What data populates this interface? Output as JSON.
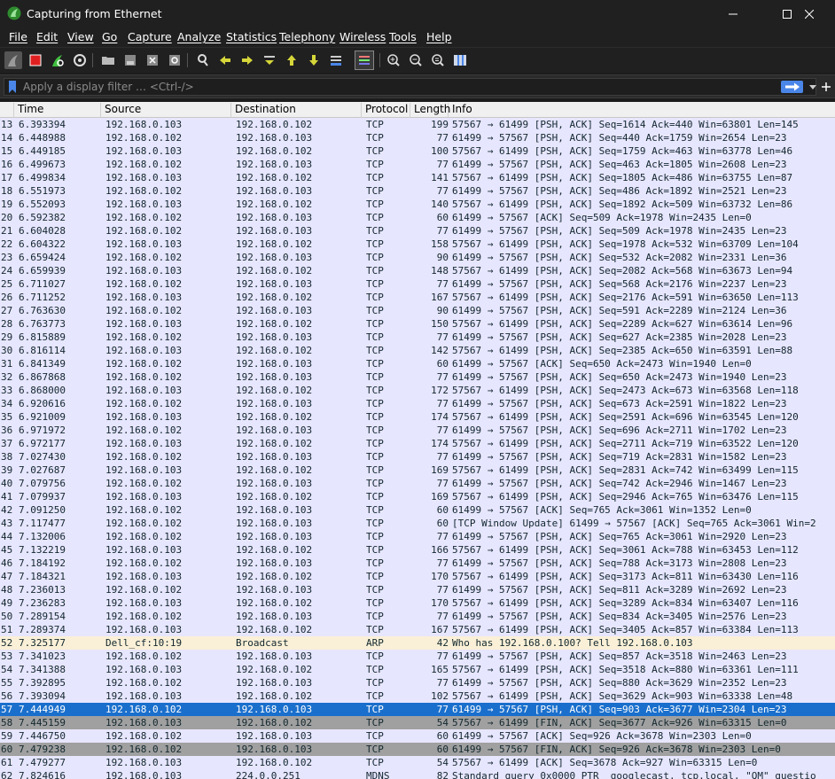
{
  "window": {
    "title": "Capturing from Ethernet"
  },
  "menu": [
    "File",
    "Edit",
    "View",
    "Go",
    "Capture",
    "Analyze",
    "Statistics",
    "Telephony",
    "Wireless",
    "Tools",
    "Help"
  ],
  "toolbar_icons": [
    "shark-fin-start-icon",
    "stop-capture-icon",
    "restart-capture-icon",
    "capture-options-icon",
    "open-file-icon",
    "save-file-icon",
    "close-file-icon",
    "reload-file-icon",
    "find-packet-icon",
    "go-back-icon",
    "go-forward-icon",
    "go-to-packet-icon",
    "go-first-icon",
    "go-last-icon",
    "autoscroll-icon",
    "colorize-icon",
    "zoom-in-icon",
    "zoom-out-icon",
    "normal-size-icon",
    "resize-columns-icon"
  ],
  "filter": {
    "placeholder": "Apply a display filter … <Ctrl-/>"
  },
  "columns": [
    "Time",
    "Source",
    "Destination",
    "Protocol",
    "Length",
    "Info"
  ],
  "colors": {
    "tcp_row": "#e7e6ff",
    "arp_row": "#faf0d7",
    "fin_row": "#a0a0a0",
    "selected_row": "#1a6fcc"
  },
  "packets": [
    {
      "no": "13",
      "time": "6.393394",
      "src": "192.168.0.103",
      "dst": "192.168.0.102",
      "proto": "TCP",
      "len": "199",
      "info": "57567 → 61499 [PSH, ACK] Seq=1614 Ack=440 Win=63801 Len=145",
      "style": "tcp"
    },
    {
      "no": "14",
      "time": "6.448988",
      "src": "192.168.0.102",
      "dst": "192.168.0.103",
      "proto": "TCP",
      "len": "77",
      "info": "61499 → 57567 [PSH, ACK] Seq=440 Ack=1759 Win=2654 Len=23",
      "style": "tcp"
    },
    {
      "no": "15",
      "time": "6.449185",
      "src": "192.168.0.103",
      "dst": "192.168.0.102",
      "proto": "TCP",
      "len": "100",
      "info": "57567 → 61499 [PSH, ACK] Seq=1759 Ack=463 Win=63778 Len=46",
      "style": "tcp"
    },
    {
      "no": "16",
      "time": "6.499673",
      "src": "192.168.0.102",
      "dst": "192.168.0.103",
      "proto": "TCP",
      "len": "77",
      "info": "61499 → 57567 [PSH, ACK] Seq=463 Ack=1805 Win=2608 Len=23",
      "style": "tcp"
    },
    {
      "no": "17",
      "time": "6.499834",
      "src": "192.168.0.103",
      "dst": "192.168.0.102",
      "proto": "TCP",
      "len": "141",
      "info": "57567 → 61499 [PSH, ACK] Seq=1805 Ack=486 Win=63755 Len=87",
      "style": "tcp"
    },
    {
      "no": "18",
      "time": "6.551973",
      "src": "192.168.0.102",
      "dst": "192.168.0.103",
      "proto": "TCP",
      "len": "77",
      "info": "61499 → 57567 [PSH, ACK] Seq=486 Ack=1892 Win=2521 Len=23",
      "style": "tcp"
    },
    {
      "no": "19",
      "time": "6.552093",
      "src": "192.168.0.103",
      "dst": "192.168.0.102",
      "proto": "TCP",
      "len": "140",
      "info": "57567 → 61499 [PSH, ACK] Seq=1892 Ack=509 Win=63732 Len=86",
      "style": "tcp"
    },
    {
      "no": "20",
      "time": "6.592382",
      "src": "192.168.0.102",
      "dst": "192.168.0.103",
      "proto": "TCP",
      "len": "60",
      "info": "61499 → 57567 [ACK] Seq=509 Ack=1978 Win=2435 Len=0",
      "style": "tcp"
    },
    {
      "no": "21",
      "time": "6.604028",
      "src": "192.168.0.102",
      "dst": "192.168.0.103",
      "proto": "TCP",
      "len": "77",
      "info": "61499 → 57567 [PSH, ACK] Seq=509 Ack=1978 Win=2435 Len=23",
      "style": "tcp"
    },
    {
      "no": "22",
      "time": "6.604322",
      "src": "192.168.0.103",
      "dst": "192.168.0.102",
      "proto": "TCP",
      "len": "158",
      "info": "57567 → 61499 [PSH, ACK] Seq=1978 Ack=532 Win=63709 Len=104",
      "style": "tcp"
    },
    {
      "no": "23",
      "time": "6.659424",
      "src": "192.168.0.102",
      "dst": "192.168.0.103",
      "proto": "TCP",
      "len": "90",
      "info": "61499 → 57567 [PSH, ACK] Seq=532 Ack=2082 Win=2331 Len=36",
      "style": "tcp"
    },
    {
      "no": "24",
      "time": "6.659939",
      "src": "192.168.0.103",
      "dst": "192.168.0.102",
      "proto": "TCP",
      "len": "148",
      "info": "57567 → 61499 [PSH, ACK] Seq=2082 Ack=568 Win=63673 Len=94",
      "style": "tcp"
    },
    {
      "no": "25",
      "time": "6.711027",
      "src": "192.168.0.102",
      "dst": "192.168.0.103",
      "proto": "TCP",
      "len": "77",
      "info": "61499 → 57567 [PSH, ACK] Seq=568 Ack=2176 Win=2237 Len=23",
      "style": "tcp"
    },
    {
      "no": "26",
      "time": "6.711252",
      "src": "192.168.0.103",
      "dst": "192.168.0.102",
      "proto": "TCP",
      "len": "167",
      "info": "57567 → 61499 [PSH, ACK] Seq=2176 Ack=591 Win=63650 Len=113",
      "style": "tcp"
    },
    {
      "no": "27",
      "time": "6.763630",
      "src": "192.168.0.102",
      "dst": "192.168.0.103",
      "proto": "TCP",
      "len": "90",
      "info": "61499 → 57567 [PSH, ACK] Seq=591 Ack=2289 Win=2124 Len=36",
      "style": "tcp"
    },
    {
      "no": "28",
      "time": "6.763773",
      "src": "192.168.0.103",
      "dst": "192.168.0.102",
      "proto": "TCP",
      "len": "150",
      "info": "57567 → 61499 [PSH, ACK] Seq=2289 Ack=627 Win=63614 Len=96",
      "style": "tcp"
    },
    {
      "no": "29",
      "time": "6.815889",
      "src": "192.168.0.102",
      "dst": "192.168.0.103",
      "proto": "TCP",
      "len": "77",
      "info": "61499 → 57567 [PSH, ACK] Seq=627 Ack=2385 Win=2028 Len=23",
      "style": "tcp"
    },
    {
      "no": "30",
      "time": "6.816114",
      "src": "192.168.0.103",
      "dst": "192.168.0.102",
      "proto": "TCP",
      "len": "142",
      "info": "57567 → 61499 [PSH, ACK] Seq=2385 Ack=650 Win=63591 Len=88",
      "style": "tcp"
    },
    {
      "no": "31",
      "time": "6.841349",
      "src": "192.168.0.102",
      "dst": "192.168.0.103",
      "proto": "TCP",
      "len": "60",
      "info": "61499 → 57567 [ACK] Seq=650 Ack=2473 Win=1940 Len=0",
      "style": "tcp"
    },
    {
      "no": "32",
      "time": "6.867868",
      "src": "192.168.0.102",
      "dst": "192.168.0.103",
      "proto": "TCP",
      "len": "77",
      "info": "61499 → 57567 [PSH, ACK] Seq=650 Ack=2473 Win=1940 Len=23",
      "style": "tcp"
    },
    {
      "no": "33",
      "time": "6.868000",
      "src": "192.168.0.103",
      "dst": "192.168.0.102",
      "proto": "TCP",
      "len": "172",
      "info": "57567 → 61499 [PSH, ACK] Seq=2473 Ack=673 Win=63568 Len=118",
      "style": "tcp"
    },
    {
      "no": "34",
      "time": "6.920616",
      "src": "192.168.0.102",
      "dst": "192.168.0.103",
      "proto": "TCP",
      "len": "77",
      "info": "61499 → 57567 [PSH, ACK] Seq=673 Ack=2591 Win=1822 Len=23",
      "style": "tcp"
    },
    {
      "no": "35",
      "time": "6.921009",
      "src": "192.168.0.103",
      "dst": "192.168.0.102",
      "proto": "TCP",
      "len": "174",
      "info": "57567 → 61499 [PSH, ACK] Seq=2591 Ack=696 Win=63545 Len=120",
      "style": "tcp"
    },
    {
      "no": "36",
      "time": "6.971972",
      "src": "192.168.0.102",
      "dst": "192.168.0.103",
      "proto": "TCP",
      "len": "77",
      "info": "61499 → 57567 [PSH, ACK] Seq=696 Ack=2711 Win=1702 Len=23",
      "style": "tcp"
    },
    {
      "no": "37",
      "time": "6.972177",
      "src": "192.168.0.103",
      "dst": "192.168.0.102",
      "proto": "TCP",
      "len": "174",
      "info": "57567 → 61499 [PSH, ACK] Seq=2711 Ack=719 Win=63522 Len=120",
      "style": "tcp"
    },
    {
      "no": "38",
      "time": "7.027430",
      "src": "192.168.0.102",
      "dst": "192.168.0.103",
      "proto": "TCP",
      "len": "77",
      "info": "61499 → 57567 [PSH, ACK] Seq=719 Ack=2831 Win=1582 Len=23",
      "style": "tcp"
    },
    {
      "no": "39",
      "time": "7.027687",
      "src": "192.168.0.103",
      "dst": "192.168.0.102",
      "proto": "TCP",
      "len": "169",
      "info": "57567 → 61499 [PSH, ACK] Seq=2831 Ack=742 Win=63499 Len=115",
      "style": "tcp"
    },
    {
      "no": "40",
      "time": "7.079756",
      "src": "192.168.0.102",
      "dst": "192.168.0.103",
      "proto": "TCP",
      "len": "77",
      "info": "61499 → 57567 [PSH, ACK] Seq=742 Ack=2946 Win=1467 Len=23",
      "style": "tcp"
    },
    {
      "no": "41",
      "time": "7.079937",
      "src": "192.168.0.103",
      "dst": "192.168.0.102",
      "proto": "TCP",
      "len": "169",
      "info": "57567 → 61499 [PSH, ACK] Seq=2946 Ack=765 Win=63476 Len=115",
      "style": "tcp"
    },
    {
      "no": "42",
      "time": "7.091250",
      "src": "192.168.0.102",
      "dst": "192.168.0.103",
      "proto": "TCP",
      "len": "60",
      "info": "61499 → 57567 [ACK] Seq=765 Ack=3061 Win=1352 Len=0",
      "style": "tcp"
    },
    {
      "no": "43",
      "time": "7.117477",
      "src": "192.168.0.102",
      "dst": "192.168.0.103",
      "proto": "TCP",
      "len": "60",
      "info": "[TCP Window Update] 61499 → 57567 [ACK] Seq=765 Ack=3061 Win=2",
      "style": "tcp"
    },
    {
      "no": "44",
      "time": "7.132006",
      "src": "192.168.0.102",
      "dst": "192.168.0.103",
      "proto": "TCP",
      "len": "77",
      "info": "61499 → 57567 [PSH, ACK] Seq=765 Ack=3061 Win=2920 Len=23",
      "style": "tcp"
    },
    {
      "no": "45",
      "time": "7.132219",
      "src": "192.168.0.103",
      "dst": "192.168.0.102",
      "proto": "TCP",
      "len": "166",
      "info": "57567 → 61499 [PSH, ACK] Seq=3061 Ack=788 Win=63453 Len=112",
      "style": "tcp"
    },
    {
      "no": "46",
      "time": "7.184192",
      "src": "192.168.0.102",
      "dst": "192.168.0.103",
      "proto": "TCP",
      "len": "77",
      "info": "61499 → 57567 [PSH, ACK] Seq=788 Ack=3173 Win=2808 Len=23",
      "style": "tcp"
    },
    {
      "no": "47",
      "time": "7.184321",
      "src": "192.168.0.103",
      "dst": "192.168.0.102",
      "proto": "TCP",
      "len": "170",
      "info": "57567 → 61499 [PSH, ACK] Seq=3173 Ack=811 Win=63430 Len=116",
      "style": "tcp"
    },
    {
      "no": "48",
      "time": "7.236013",
      "src": "192.168.0.102",
      "dst": "192.168.0.103",
      "proto": "TCP",
      "len": "77",
      "info": "61499 → 57567 [PSH, ACK] Seq=811 Ack=3289 Win=2692 Len=23",
      "style": "tcp"
    },
    {
      "no": "49",
      "time": "7.236283",
      "src": "192.168.0.103",
      "dst": "192.168.0.102",
      "proto": "TCP",
      "len": "170",
      "info": "57567 → 61499 [PSH, ACK] Seq=3289 Ack=834 Win=63407 Len=116",
      "style": "tcp"
    },
    {
      "no": "50",
      "time": "7.289154",
      "src": "192.168.0.102",
      "dst": "192.168.0.103",
      "proto": "TCP",
      "len": "77",
      "info": "61499 → 57567 [PSH, ACK] Seq=834 Ack=3405 Win=2576 Len=23",
      "style": "tcp"
    },
    {
      "no": "51",
      "time": "7.289374",
      "src": "192.168.0.103",
      "dst": "192.168.0.102",
      "proto": "TCP",
      "len": "167",
      "info": "57567 → 61499 [PSH, ACK] Seq=3405 Ack=857 Win=63384 Len=113",
      "style": "tcp"
    },
    {
      "no": "52",
      "time": "7.325177",
      "src": "Dell_cf:10:19",
      "dst": "Broadcast",
      "proto": "ARP",
      "len": "42",
      "info": "Who has 192.168.0.100? Tell 192.168.0.103",
      "style": "arp"
    },
    {
      "no": "53",
      "time": "7.341023",
      "src": "192.168.0.102",
      "dst": "192.168.0.103",
      "proto": "TCP",
      "len": "77",
      "info": "61499 → 57567 [PSH, ACK] Seq=857 Ack=3518 Win=2463 Len=23",
      "style": "tcp"
    },
    {
      "no": "54",
      "time": "7.341388",
      "src": "192.168.0.103",
      "dst": "192.168.0.102",
      "proto": "TCP",
      "len": "165",
      "info": "57567 → 61499 [PSH, ACK] Seq=3518 Ack=880 Win=63361 Len=111",
      "style": "tcp"
    },
    {
      "no": "55",
      "time": "7.392895",
      "src": "192.168.0.102",
      "dst": "192.168.0.103",
      "proto": "TCP",
      "len": "77",
      "info": "61499 → 57567 [PSH, ACK] Seq=880 Ack=3629 Win=2352 Len=23",
      "style": "tcp"
    },
    {
      "no": "56",
      "time": "7.393094",
      "src": "192.168.0.103",
      "dst": "192.168.0.102",
      "proto": "TCP",
      "len": "102",
      "info": "57567 → 61499 [PSH, ACK] Seq=3629 Ack=903 Win=63338 Len=48",
      "style": "tcp"
    },
    {
      "no": "57",
      "time": "7.444949",
      "src": "192.168.0.102",
      "dst": "192.168.0.103",
      "proto": "TCP",
      "len": "77",
      "info": "61499 → 57567 [PSH, ACK] Seq=903 Ack=3677 Win=2304 Len=23",
      "style": "sel"
    },
    {
      "no": "58",
      "time": "7.445159",
      "src": "192.168.0.103",
      "dst": "192.168.0.102",
      "proto": "TCP",
      "len": "54",
      "info": "57567 → 61499 [FIN, ACK] Seq=3677 Ack=926 Win=63315 Len=0",
      "style": "fin"
    },
    {
      "no": "59",
      "time": "7.446750",
      "src": "192.168.0.102",
      "dst": "192.168.0.103",
      "proto": "TCP",
      "len": "60",
      "info": "61499 → 57567 [ACK] Seq=926 Ack=3678 Win=2303 Len=0",
      "style": "tcp"
    },
    {
      "no": "60",
      "time": "7.479238",
      "src": "192.168.0.102",
      "dst": "192.168.0.103",
      "proto": "TCP",
      "len": "60",
      "info": "61499 → 57567 [FIN, ACK] Seq=926 Ack=3678 Win=2303 Len=0",
      "style": "fin"
    },
    {
      "no": "61",
      "time": "7.479277",
      "src": "192.168.0.103",
      "dst": "192.168.0.102",
      "proto": "TCP",
      "len": "54",
      "info": "57567 → 61499 [ACK] Seq=3678 Ack=927 Win=63315 Len=0",
      "style": "tcp"
    },
    {
      "no": "62",
      "time": "7.824616",
      "src": "192.168.0.103",
      "dst": "224.0.0.251",
      "proto": "MDNS",
      "len": "82",
      "info": "Standard query 0x0000 PTR _googlecast._tcp.local, \"QM\" questio",
      "style": "tcp"
    }
  ]
}
